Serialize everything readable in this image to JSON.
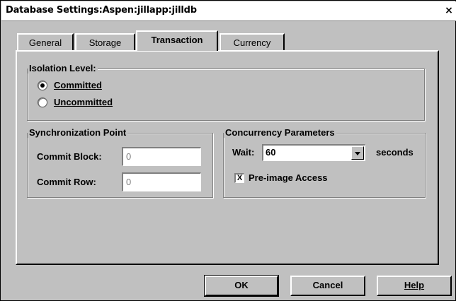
{
  "window": {
    "title": "Database Settings:Aspen:jillapp:jilldb",
    "close_glyph": "×"
  },
  "tabs": [
    {
      "label": "General",
      "active": false
    },
    {
      "label": "Storage",
      "active": false
    },
    {
      "label": "Transaction",
      "active": true
    },
    {
      "label": "Currency",
      "active": false
    }
  ],
  "isolation": {
    "legend": "Isolation Level:",
    "options": [
      {
        "label": "Committed",
        "selected": true
      },
      {
        "label": "Uncommitted",
        "selected": false
      }
    ]
  },
  "sync": {
    "legend": "Synchronization Point",
    "commit_block_label": "Commit Block:",
    "commit_block_value": "0",
    "commit_row_label": "Commit Row:",
    "commit_row_value": "0"
  },
  "concurrency": {
    "legend": "Concurrency Parameters",
    "wait_label": "Wait:",
    "wait_value": "60",
    "wait_unit": "seconds",
    "preimage_label": "Pre-image Access",
    "preimage_checked": true,
    "check_glyph": "X"
  },
  "buttons": {
    "ok": "OK",
    "cancel": "Cancel",
    "help": "Help"
  }
}
